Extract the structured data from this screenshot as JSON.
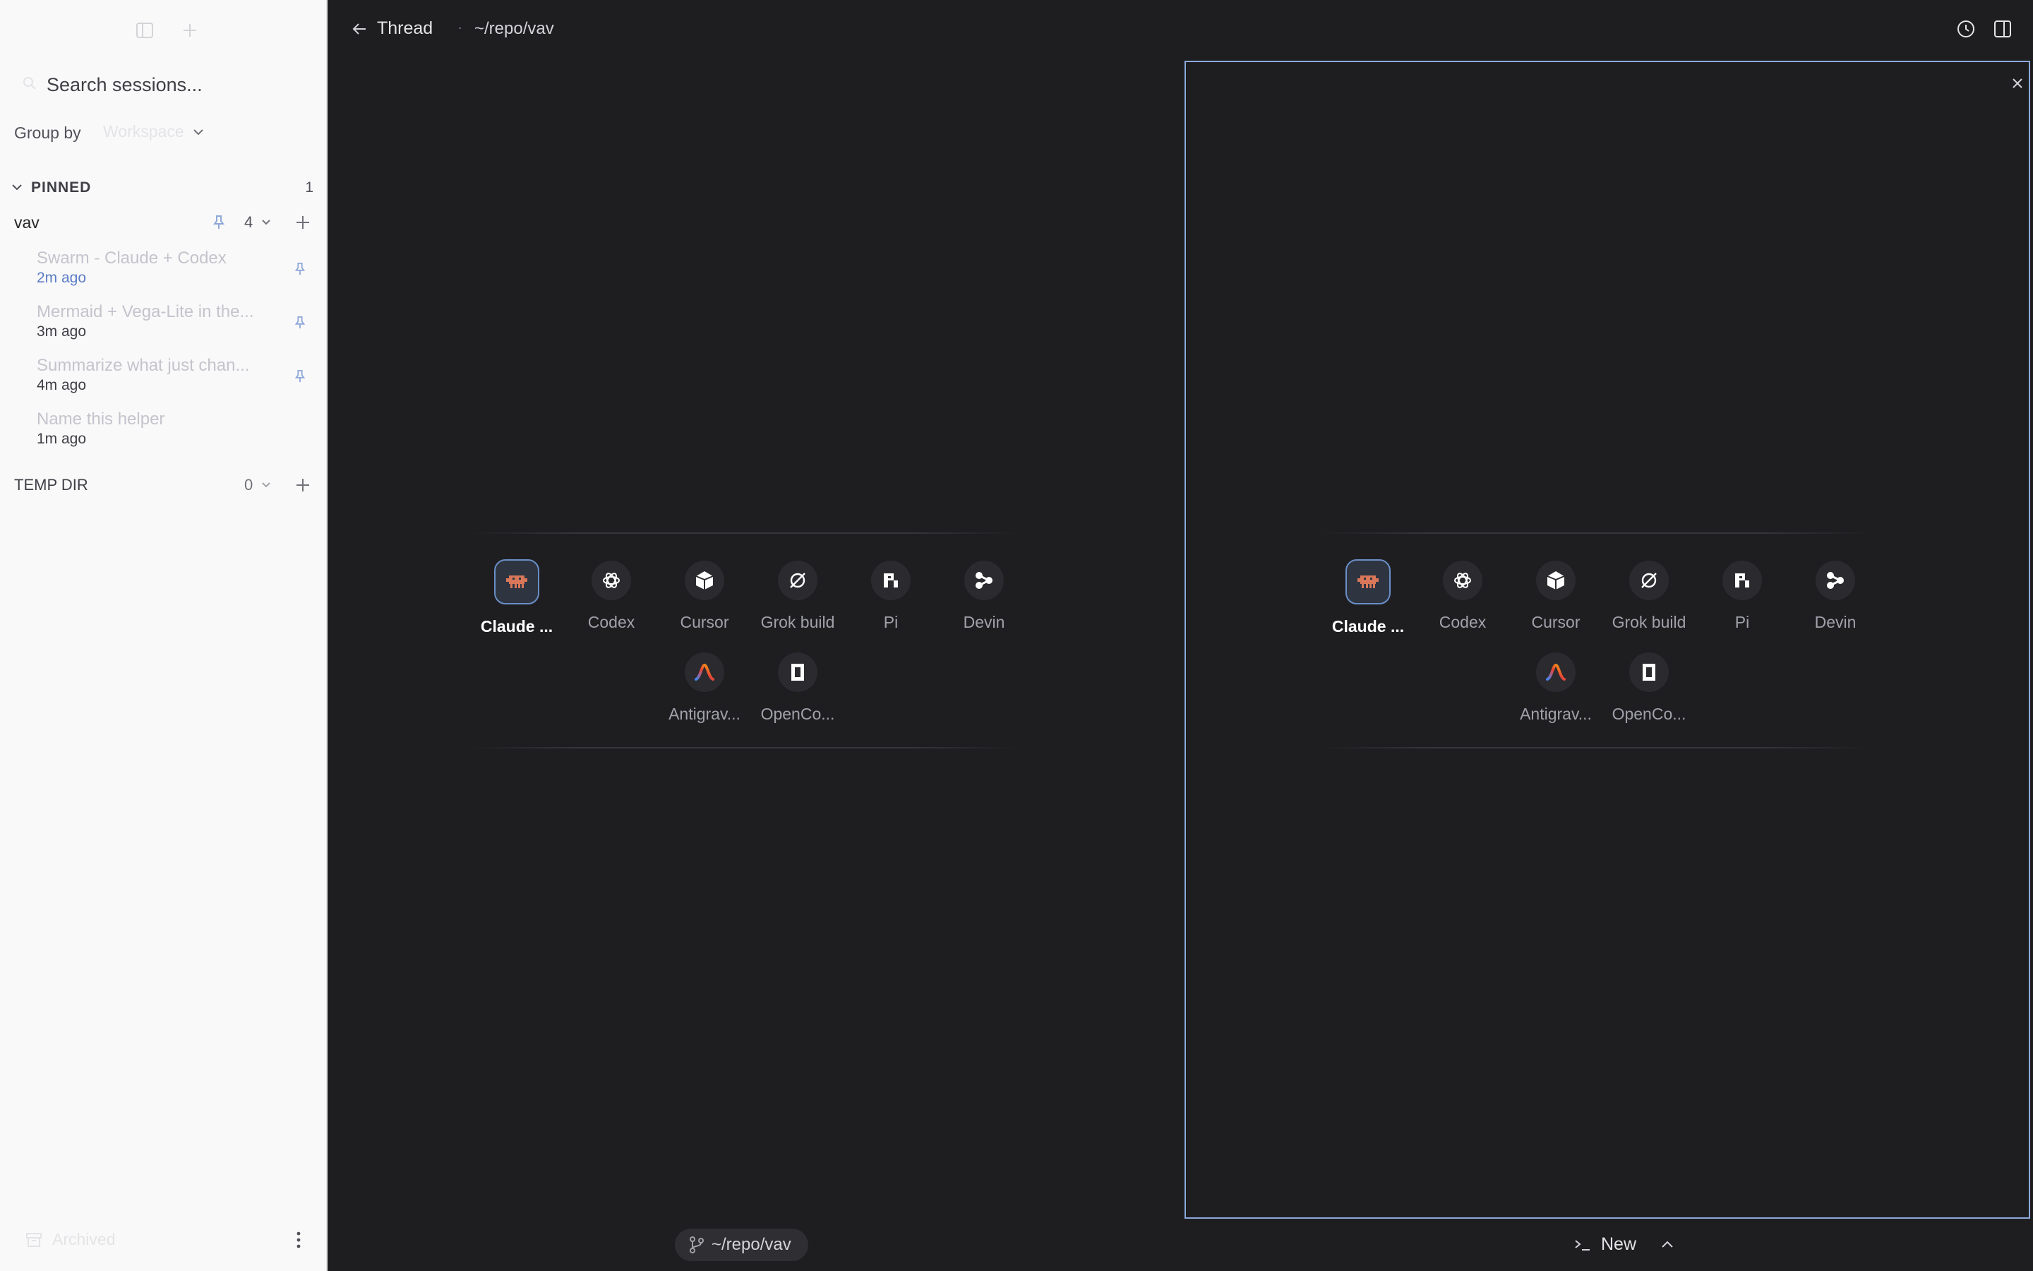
{
  "sidebar": {
    "search_placeholder": "Search sessions...",
    "group_by_label": "Group by",
    "group_by_value": "Workspace",
    "pinned": {
      "label": "PINNED",
      "count": "1"
    },
    "workspace": {
      "name": "vav",
      "count": "4"
    },
    "sessions": [
      {
        "title": "Swarm - Claude + Codex",
        "time": "2m ago",
        "pinned": true
      },
      {
        "title": "Mermaid + Vega-Lite in the...",
        "time": "3m ago",
        "pinned": true
      },
      {
        "title": "Summarize what just chan...",
        "time": "4m ago",
        "pinned": true
      },
      {
        "title": "Name this helper",
        "time": "1m ago",
        "pinned": false
      }
    ],
    "temp_dir": {
      "label": "TEMP DIR",
      "count": "0"
    },
    "archived_label": "Archived"
  },
  "header": {
    "back_label": "Thread",
    "separator": "·",
    "path": "~/repo/vav"
  },
  "agents": [
    {
      "label": "Claude ...",
      "icon": "claude-icon",
      "selected": true
    },
    {
      "label": "Codex",
      "icon": "codex-icon",
      "selected": false
    },
    {
      "label": "Cursor",
      "icon": "cursor-icon",
      "selected": false
    },
    {
      "label": "Grok build",
      "icon": "grok-icon",
      "selected": false
    },
    {
      "label": "Pi",
      "icon": "pi-icon",
      "selected": false
    },
    {
      "label": "Devin",
      "icon": "devin-icon",
      "selected": false
    },
    {
      "label": "Antigrav...",
      "icon": "antigravity-icon",
      "selected": false
    },
    {
      "label": "OpenCo...",
      "icon": "opencode-icon",
      "selected": false
    }
  ],
  "footer": {
    "branch_path": "~/repo/vav",
    "new_label": "New"
  },
  "colors": {
    "accent": "#6a8fc7",
    "claude": "#d9775a",
    "background": "#1e1e21",
    "sidebar": "#f9f9fa"
  }
}
